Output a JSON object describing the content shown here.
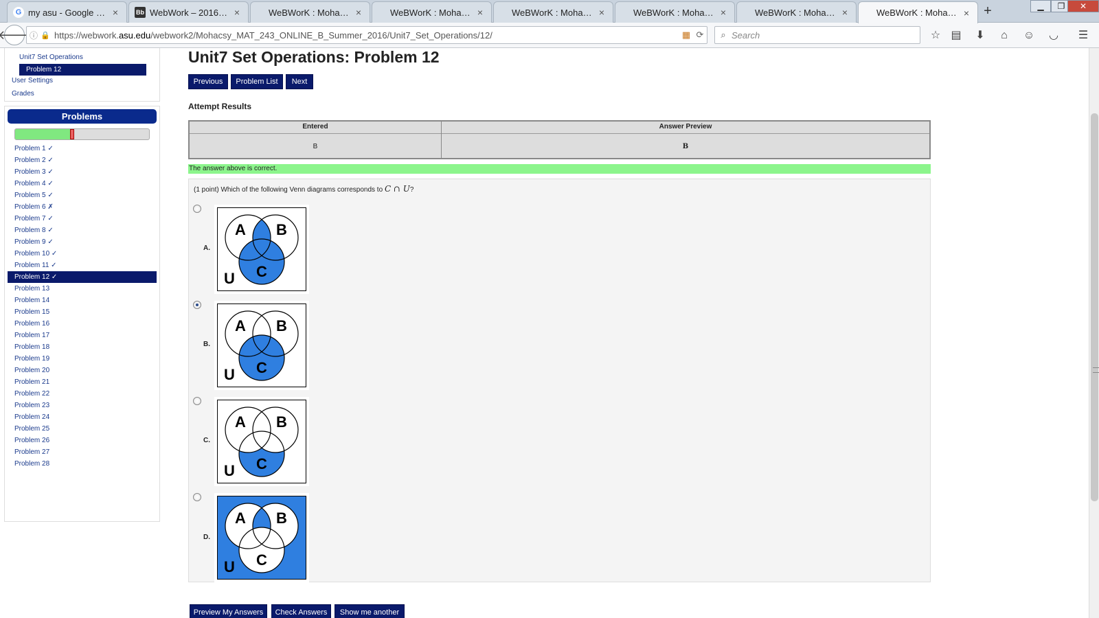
{
  "browser": {
    "tabs": [
      {
        "label": "my asu - Google Sea...",
        "favicon": "G",
        "favicon_bg": "#ffffff",
        "favicon_color": "#4285f4"
      },
      {
        "label": "WebWork – 2016Su...",
        "favicon": "Bb",
        "favicon_bg": "#333333",
        "favicon_color": "#ffffff"
      },
      {
        "label": "WeBWorK : Mohacs...",
        "favicon": "",
        "favicon_bg": "",
        "favicon_color": ""
      },
      {
        "label": "WeBWorK : Mohacs...",
        "favicon": "",
        "favicon_bg": "",
        "favicon_color": ""
      },
      {
        "label": "WeBWorK : Mohacs...",
        "favicon": "",
        "favicon_bg": "",
        "favicon_color": ""
      },
      {
        "label": "WeBWorK : Mohacs...",
        "favicon": "",
        "favicon_bg": "",
        "favicon_color": ""
      },
      {
        "label": "WeBWorK : Mohacs...",
        "favicon": "",
        "favicon_bg": "",
        "favicon_color": ""
      },
      {
        "label": "WeBWorK : Mohacs...",
        "favicon": "",
        "favicon_bg": "",
        "favicon_color": "",
        "active": true
      }
    ],
    "url_prefix": "https://webwork.",
    "url_domain": "asu.edu",
    "url_path": "/webwork2/Mohacsy_MAT_243_ONLINE_B_Summer_2016/Unit7_Set_Operations/12/",
    "search_placeholder": "Search"
  },
  "sidebar": {
    "set_link": "Unit7 Set Operations",
    "current_problem": "Problem 12",
    "user_settings": "User Settings",
    "grades": "Grades",
    "problems_heading": "Problems",
    "progress_correct_fraction": 0.41,
    "progress_marker_fraction": 0.41,
    "problems": [
      {
        "label": "Problem 1 ✓"
      },
      {
        "label": "Problem 2 ✓"
      },
      {
        "label": "Problem 3 ✓"
      },
      {
        "label": "Problem 4 ✓"
      },
      {
        "label": "Problem 5 ✓"
      },
      {
        "label": "Problem 6 ✗"
      },
      {
        "label": "Problem 7 ✓"
      },
      {
        "label": "Problem 8 ✓"
      },
      {
        "label": "Problem 9 ✓"
      },
      {
        "label": "Problem 10 ✓"
      },
      {
        "label": "Problem 11 ✓"
      },
      {
        "label": "Problem 12 ✓",
        "selected": true
      },
      {
        "label": "Problem 13"
      },
      {
        "label": "Problem 14"
      },
      {
        "label": "Problem 15"
      },
      {
        "label": "Problem 16"
      },
      {
        "label": "Problem 17"
      },
      {
        "label": "Problem 18"
      },
      {
        "label": "Problem 19"
      },
      {
        "label": "Problem 20"
      },
      {
        "label": "Problem 21"
      },
      {
        "label": "Problem 22"
      },
      {
        "label": "Problem 23"
      },
      {
        "label": "Problem 24"
      },
      {
        "label": "Problem 25"
      },
      {
        "label": "Problem 26"
      },
      {
        "label": "Problem 27"
      },
      {
        "label": "Problem 28"
      }
    ]
  },
  "main": {
    "title": "Unit7 Set Operations: Problem 12",
    "buttons": {
      "previous": "Previous",
      "problem_list": "Problem List",
      "next": "Next"
    },
    "attempt_heading": "Attempt Results",
    "results": {
      "col_entered": "Entered",
      "col_preview": "Answer Preview",
      "entered": "B",
      "preview": "B"
    },
    "correct_message": "The answer above is correct.",
    "question_prefix": "(1 point) Which of the following Venn diagrams corresponds to ",
    "question_math": "C ∩ U",
    "question_suffix": "?",
    "options": [
      {
        "label": "A.",
        "checked": false
      },
      {
        "label": "B.",
        "checked": true
      },
      {
        "label": "C.",
        "checked": false
      },
      {
        "label": "D.",
        "checked": false
      }
    ],
    "venn_labels": {
      "a": "A",
      "b": "B",
      "c": "C",
      "u": "U"
    },
    "shade_color": "#2f7fe0",
    "bottom_buttons": {
      "preview": "Preview My Answers",
      "check": "Check Answers",
      "show_another": "Show me another"
    }
  }
}
